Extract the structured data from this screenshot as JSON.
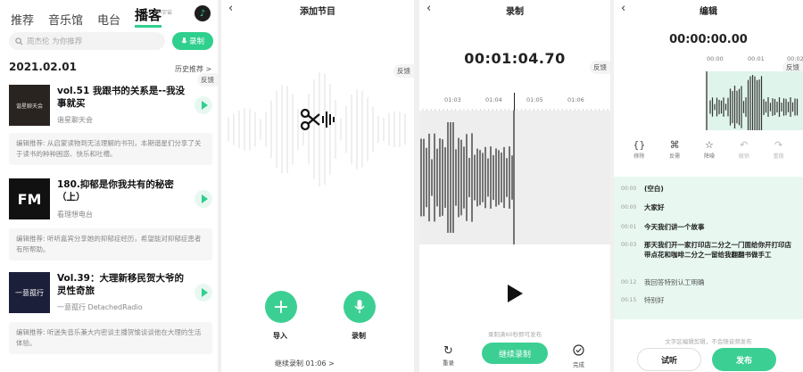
{
  "panel1": {
    "tabs": [
      "推荐",
      "音乐馆",
      "电台",
      "播客"
    ],
    "tab_sub": "小宇宙",
    "search_placeholder": "周杰伦  为你推荐",
    "record_label": "录制",
    "date": "2021.02.01",
    "history_label": "历史推荐 >",
    "feedback": "反馈",
    "episodes": [
      {
        "cover_text": "谐星聊天会",
        "title": "vol.51 我跟书的关系是--我没事就买",
        "author": "谐星聊天会",
        "desc": "编辑推荐: 从启蒙读物到无法理解的书刊，本期谐星们分享了关于读书的种种困惑、快乐和吐槽。"
      },
      {
        "cover_text": "FM",
        "title": "180.抑郁是你我共有的秘密（上）",
        "author": "看理想电台",
        "desc": "编辑推荐: 听听嘉宾分享她的抑郁症经历，希望能对抑郁症患者有所帮助。"
      },
      {
        "cover_text": "一意孤行",
        "title": "Vol.39：大理新移民贺大爷的灵性奇旅",
        "author": "一意孤行 DetachedRadio",
        "desc": "编辑推荐: 听迷失音乐兼大内密谈主播贺愉谈谈他在大理的生活体验。"
      }
    ]
  },
  "panel2": {
    "title": "添加节目",
    "feedback": "反馈",
    "import_label": "导入",
    "record_label": "录制",
    "continue_label": "继续录制 01:06  >"
  },
  "panel3": {
    "title": "录制",
    "feedback": "反馈",
    "timer": "00:01:04.70",
    "ticks": [
      "01:03",
      "01:04",
      "01:05",
      "01:06"
    ],
    "hint": "录制满60秒即可发布",
    "redo_label": "重录",
    "continue_label": "继续录制",
    "done_label": "完成"
  },
  "panel4": {
    "title": "编辑",
    "feedback": "反馈",
    "timer": "00:00:00.00",
    "ticks": [
      "00:00",
      "00:01",
      "00:02"
    ],
    "tools": [
      {
        "icon": "{}",
        "label": "移除"
      },
      {
        "icon": "⌘",
        "label": "反需"
      },
      {
        "icon": "☆",
        "label": "降噪"
      },
      {
        "icon": "↶",
        "label": "撤销"
      },
      {
        "icon": "↷",
        "label": "重做"
      }
    ],
    "lines": [
      {
        "t": "00:00",
        "text": "(空白)"
      },
      {
        "t": "00:00",
        "text": "大家好"
      },
      {
        "t": "00:01",
        "text": "今天我们讲一个故事"
      },
      {
        "t": "00:03",
        "text": "那天我们开一家打印店二分之一门面给你开打印店带点花和咖啡二分之一留给我翻翻书做手工"
      },
      {
        "t": "00:12",
        "text": "我回答特别认工明确"
      },
      {
        "t": "00:15",
        "text": "特别好"
      }
    ],
    "hint": "文字区编辑剪辑，不会随音频发布",
    "listen_label": "试听",
    "publish_label": "发布"
  }
}
